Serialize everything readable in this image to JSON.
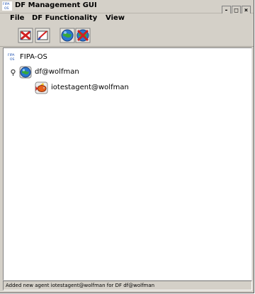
{
  "window": {
    "title": "DF Management GUI",
    "controls": {
      "minimize": "-",
      "maximize": "□",
      "close": "×"
    },
    "title_icon": "fipa-os-icon"
  },
  "menubar": {
    "items": [
      {
        "label": "File"
      },
      {
        "label": "DF Functionality"
      },
      {
        "label": "View"
      }
    ]
  },
  "toolbar": {
    "buttons": [
      {
        "icon": "deregister-red-x-icon"
      },
      {
        "icon": "modify-registration-icon"
      },
      {
        "icon": "search-globe-icon"
      },
      {
        "icon": "deregister-globe-x-icon"
      }
    ]
  },
  "tree": {
    "root": {
      "label": "FIPA-OS",
      "icon": "fipa-os-icon"
    },
    "df_node": {
      "label": "df@wolfman",
      "icon": "df-globe-icon",
      "expanded": true,
      "expander": "⚲"
    },
    "agent_node": {
      "label": "iotestagent@wolfman",
      "icon": "agent-fish-icon"
    }
  },
  "status": {
    "message": "Added new agent iotestagent@wolfman for DF df@wolfman"
  },
  "colors": {
    "chrome": "#d4d0c8",
    "tree_background": "#ffffff",
    "accent_red": "#d22020",
    "globe_blue": "#2a78d0"
  }
}
